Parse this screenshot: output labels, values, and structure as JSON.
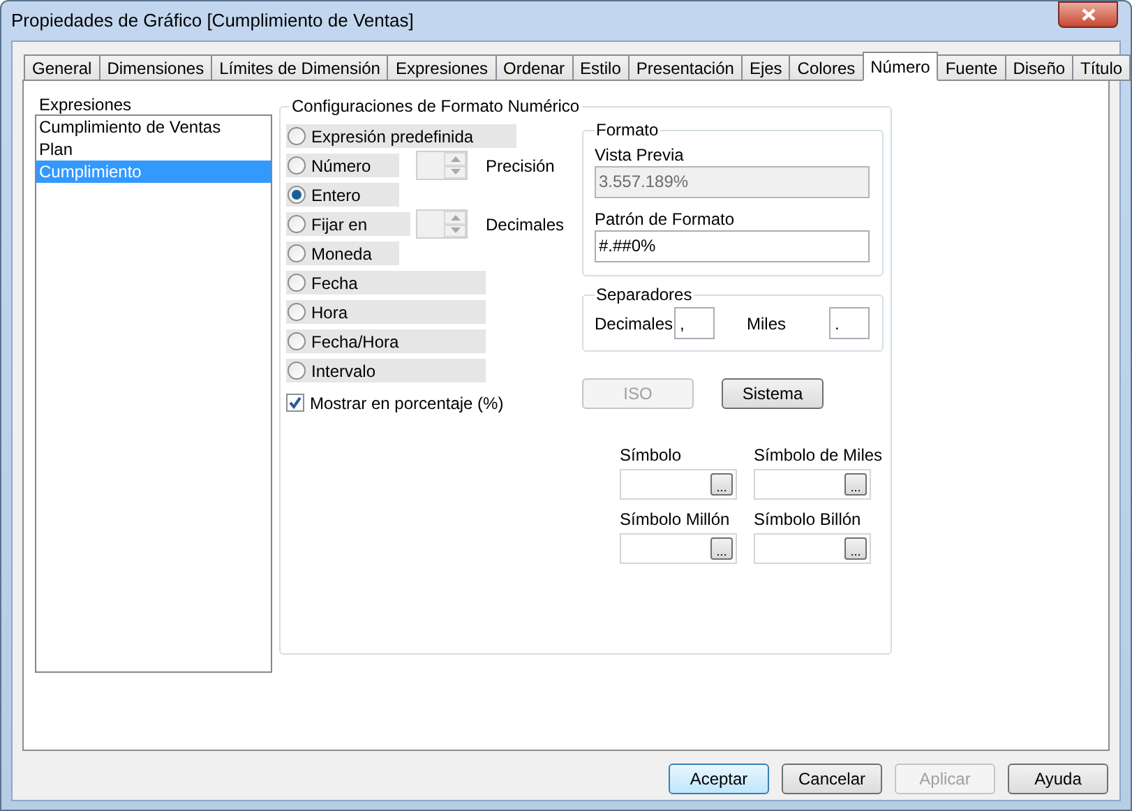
{
  "window": {
    "title": "Propiedades de Gráfico [Cumplimiento de Ventas]"
  },
  "tabs": [
    {
      "label": "General",
      "selected": false
    },
    {
      "label": "Dimensiones",
      "selected": false
    },
    {
      "label": "Límites de Dimensión",
      "selected": false
    },
    {
      "label": "Expresiones",
      "selected": false
    },
    {
      "label": "Ordenar",
      "selected": false
    },
    {
      "label": "Estilo",
      "selected": false
    },
    {
      "label": "Presentación",
      "selected": false
    },
    {
      "label": "Ejes",
      "selected": false
    },
    {
      "label": "Colores",
      "selected": false
    },
    {
      "label": "Número",
      "selected": true
    },
    {
      "label": "Fuente",
      "selected": false
    },
    {
      "label": "Diseño",
      "selected": false
    },
    {
      "label": "Título",
      "selected": false
    }
  ],
  "expressions": {
    "label": "Expresiones",
    "items": [
      {
        "label": "Cumplimiento de Ventas",
        "selected": false
      },
      {
        "label": "Plan",
        "selected": false
      },
      {
        "label": "Cumplimiento",
        "selected": true
      }
    ]
  },
  "number_format": {
    "title": "Configuraciones de Formato Numérico",
    "options": [
      {
        "label": "Expresión predefinida",
        "selected": false,
        "kind": "wide"
      },
      {
        "label": "Número",
        "selected": false,
        "kind": "spinner",
        "spinner_label": "Precisión"
      },
      {
        "label": "Entero",
        "selected": true,
        "kind": "short"
      },
      {
        "label": "Fijar en",
        "selected": false,
        "kind": "spinner",
        "spinner_label": "Decimales"
      },
      {
        "label": "Moneda",
        "selected": false,
        "kind": "short"
      },
      {
        "label": "Fecha",
        "selected": false,
        "kind": "medium"
      },
      {
        "label": "Hora",
        "selected": false,
        "kind": "medium"
      },
      {
        "label": "Fecha/Hora",
        "selected": false,
        "kind": "medium"
      },
      {
        "label": "Intervalo",
        "selected": false,
        "kind": "medium"
      }
    ],
    "percent": {
      "label": "Mostrar en porcentaje (%)",
      "checked": true
    },
    "format": {
      "title": "Formato",
      "preview_label": "Vista Previa",
      "preview": "3.557.189%",
      "pattern_label": "Patrón de Formato",
      "pattern": "#.##0%"
    },
    "separators": {
      "title": "Separadores",
      "decimal_label": "Decimales",
      "decimal": ",",
      "thousands_label": "Miles",
      "thousands": "."
    },
    "buttons": [
      {
        "label": "ISO",
        "disabled": true
      },
      {
        "label": "Sistema",
        "disabled": false
      }
    ],
    "symbols": [
      {
        "label": "Símbolo",
        "button": "..."
      },
      {
        "label": "Símbolo de Miles",
        "button": "..."
      },
      {
        "label": "Símbolo Millón",
        "button": "..."
      },
      {
        "label": "Símbolo Billón",
        "button": "..."
      }
    ]
  },
  "footer_buttons": [
    {
      "label": "Aceptar",
      "default": true,
      "disabled": false
    },
    {
      "label": "Cancelar",
      "default": false,
      "disabled": false
    },
    {
      "label": "Aplicar",
      "default": false,
      "disabled": true
    },
    {
      "label": "Ayuda",
      "default": false,
      "disabled": false
    }
  ]
}
